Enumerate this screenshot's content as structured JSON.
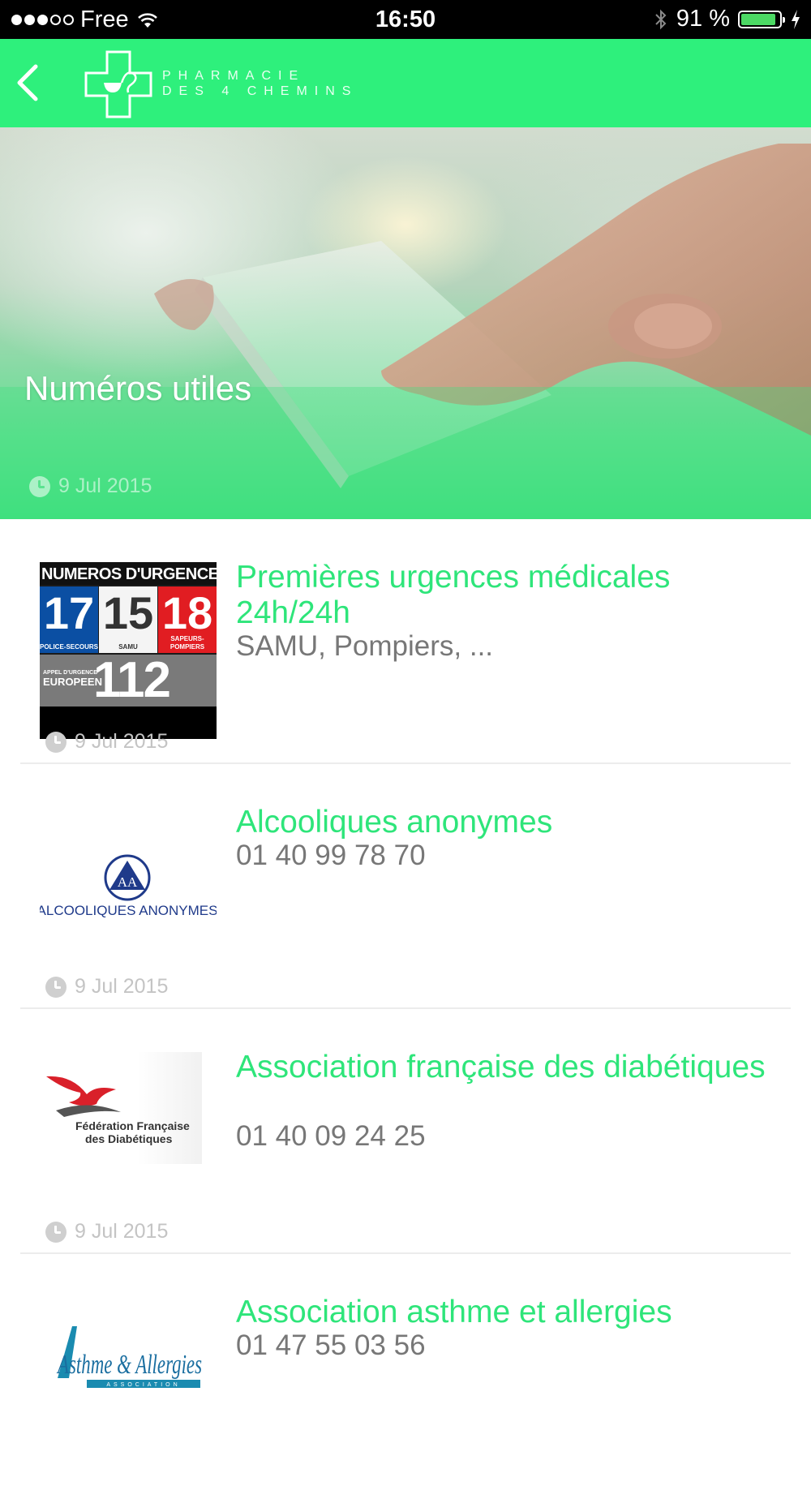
{
  "status_bar": {
    "carrier": "Free",
    "time": "16:50",
    "battery_percent": "91 %",
    "battery_level": 0.91,
    "signal_dots_filled": 3,
    "signal_dots_total": 5
  },
  "nav": {
    "logo_line1": "PHARMACIE",
    "logo_line2": "DES 4 CHEMINS",
    "accent_color": "#2ef07c"
  },
  "hero": {
    "title": "Numéros utiles",
    "date": "9 Jul 2015"
  },
  "items": [
    {
      "title": "Premières urgences médicales 24h/24h",
      "subtitle": "SAMU, Pompiers, ...",
      "date": "9 Jul 2015",
      "thumb": {
        "header": "NUMEROS D'URGENCE",
        "cells": [
          {
            "number": "17",
            "label": "POLICE-SECOURS"
          },
          {
            "number": "15",
            "label": "SAMU"
          },
          {
            "number": "18",
            "label": "SAPEURS-POMPIERS"
          }
        ],
        "eu_label_1": "APPEL D'URGENCE",
        "eu_label_2": "EUROPEEN",
        "eu_number": "112"
      }
    },
    {
      "title": "Alcooliques anonymes",
      "subtitle": "01 40 99 78 70",
      "date": "9 Jul 2015",
      "thumb": {
        "logo_text": "ALCOOLIQUES ANONYMES",
        "emblem": "AA"
      }
    },
    {
      "title": "Association française des diabétiques",
      "subtitle": "01 40 09 24 25",
      "date": "9 Jul 2015",
      "thumb": {
        "logo_line1": "Fédération Française",
        "logo_line2": "des Diabétiques"
      }
    },
    {
      "title": "Association asthme et allergies",
      "subtitle": "01 47 55 03 56",
      "thumb": {
        "logo_text": "Asthme & Allergies",
        "logo_sub": "ASSOCIATION"
      }
    }
  ]
}
